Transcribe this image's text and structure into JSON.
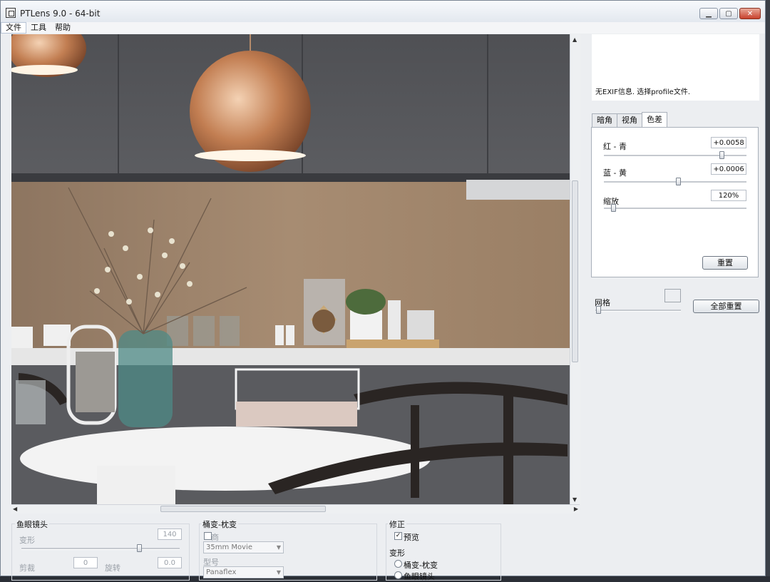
{
  "window": {
    "title": "PTLens 9.0 - 64-bit"
  },
  "menu": {
    "items": [
      "文件",
      "工具",
      "帮助"
    ]
  },
  "info": {
    "text": "无EXIF信息. 选择profile文件."
  },
  "tabs": [
    "暗角",
    "视角",
    "色差"
  ],
  "chromatic": {
    "red_cyan": {
      "label": "红 - 青",
      "value": "+0.0058",
      "level": 0.85
    },
    "blue_yellow": {
      "label": "蓝 - 黄",
      "value": "+0.0006",
      "level": 0.53
    },
    "zoom": {
      "label": "缩放",
      "value": "120%",
      "level": 0.05
    },
    "reset_label": "重置"
  },
  "grid": {
    "label": "网格",
    "level": 0.0
  },
  "reset_all_label": "全部重置",
  "fisheye": {
    "title": "鱼眼镜头",
    "distortion_label": "变形",
    "distortion_value": "140",
    "crop_label": "剪裁",
    "crop_value": "0",
    "rotate_label": "旋转",
    "rotate_value": "0.0"
  },
  "pincushion": {
    "title": "桶变-枕变",
    "business_label": "商",
    "model_combo": "35mm Movie",
    "model_label": "型号",
    "lens_combo": "Panaflex"
  },
  "correction": {
    "title": "修正",
    "preview_label": "预览",
    "transform_label": "变形",
    "option1": "桶变-枕变",
    "option2": "鱼眼镜头"
  },
  "colors": {
    "accent": "#c8412c",
    "panel": "#eceef1"
  }
}
